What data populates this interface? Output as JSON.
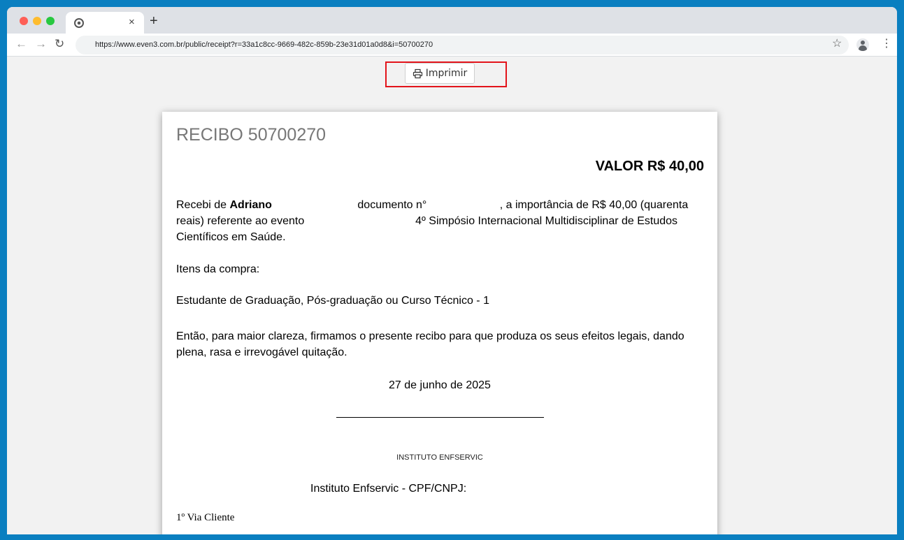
{
  "browser": {
    "tab_close": "×",
    "new_tab": "+",
    "nav": {
      "back": "←",
      "forward": "→",
      "reload": "↻"
    },
    "url": "https://www.even3.com.br/public/receipt?r=33a1c8cc-9669-482c-859b-23e31d01a0d8&i=50700270",
    "star": "☆",
    "menu": "⋮"
  },
  "page": {
    "print_label": "Imprimir",
    "receipt": {
      "title": "RECIBO 50700270",
      "value": "VALOR R$ 40,00",
      "p1_a": "Recebi de ",
      "p1_name": "Adriano",
      "p1_b": " documento n° ",
      "p1_c": ", a importância de R$ 40,00 (quarenta reais) referente ao evento ",
      "p1_d": " 4º Simpósio Internacional Multidisciplinar de Estudos Científicos em Saúde.",
      "items_title": "Itens da compra:",
      "item": "Estudante de Graduação, Pós-graduação ou Curso Técnico - 1",
      "closing": "Então, para maior clareza, firmamos o presente recibo para que produza os seus efeitos legais, dando plena, rasa e irrevogável quitação.",
      "date": "27 de junho de 2025",
      "org_name": "INSTITUTO ENFSERVIC",
      "org_cnpj": "Instituto Enfservic - CPF/CNPJ:",
      "via": "1º Via Cliente"
    }
  }
}
